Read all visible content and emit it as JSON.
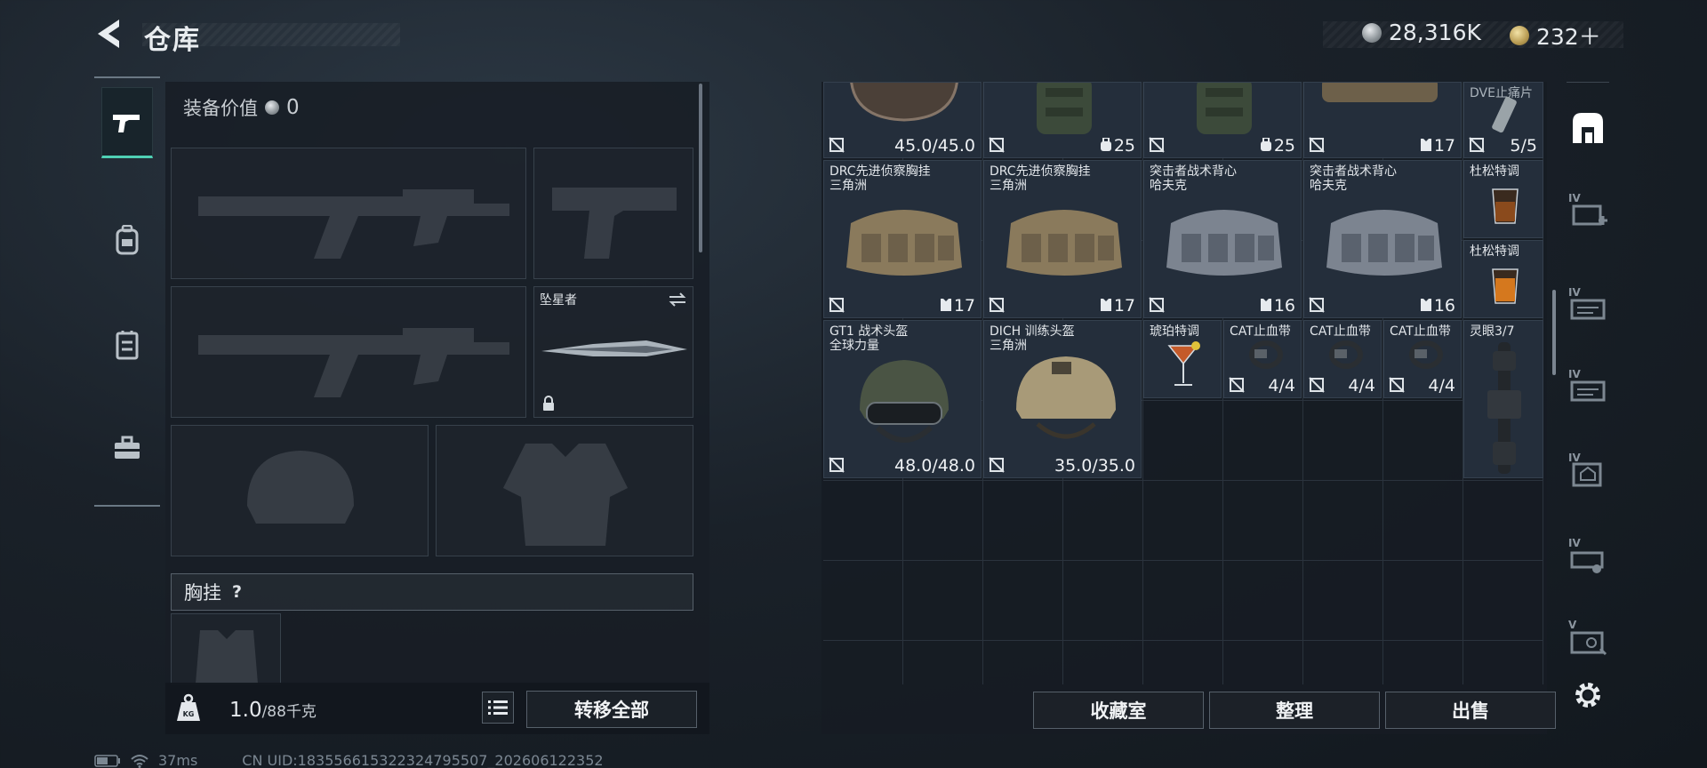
{
  "header": {
    "title": "仓库",
    "currency_primary": "28,316K",
    "currency_secondary": "232＋"
  },
  "sidebar": {
    "tabs": [
      {
        "name": "pistol-icon",
        "active": true
      },
      {
        "name": "backpack-icon",
        "active": false
      },
      {
        "name": "vest-icon",
        "active": false
      },
      {
        "name": "toolbox-icon",
        "active": false
      }
    ]
  },
  "loadout": {
    "equip_value_label": "装备价值",
    "equip_value": "0",
    "melee_name": "坠星者",
    "chest_rig_label": "胸挂",
    "help_mark": "?",
    "weight_value": "1.0",
    "weight_max": "/88千克",
    "transfer_all": "转移全部"
  },
  "storage": {
    "top_row": [
      {
        "value": "45.0/45.0"
      },
      {
        "value": "25"
      },
      {
        "value": "25"
      },
      {
        "value": "17"
      },
      {
        "name": "DVE止痛片",
        "value": "5/5"
      }
    ],
    "row2": [
      {
        "name": "DRC先进侦察胸挂\n三角洲",
        "value": "17"
      },
      {
        "name": "DRC先进侦察胸挂\n三角洲",
        "value": "17"
      },
      {
        "name": "突击者战术背心\n哈夫克",
        "value": "16"
      },
      {
        "name": "突击者战术背心\n哈夫克",
        "value": "16"
      }
    ],
    "drinks": [
      {
        "name": "杜松特调"
      },
      {
        "name": "杜松特调"
      }
    ],
    "helmets": [
      {
        "name": "GT1 战术头盔\n全球力量",
        "value": "48.0/48.0"
      },
      {
        "name": "DICH 训练头盔\n三角洲",
        "value": "35.0/35.0"
      }
    ],
    "small": [
      {
        "name": "琥珀特调",
        "value": ""
      },
      {
        "name": "CAT止血带",
        "value": "4/4"
      },
      {
        "name": "CAT止血带",
        "value": "4/4"
      },
      {
        "name": "CAT止血带",
        "value": "4/4"
      }
    ],
    "scope": {
      "name": "灵眼3/7"
    },
    "buttons": {
      "collection": "收藏室",
      "sort": "整理",
      "sell": "出售"
    }
  },
  "rail": {
    "tiers": [
      "IV",
      "IV",
      "IV",
      "IV",
      "IV",
      "V"
    ]
  },
  "status": {
    "ping": "37ms",
    "uid": "CN UID:1835566153223247955​07_202606122352"
  }
}
